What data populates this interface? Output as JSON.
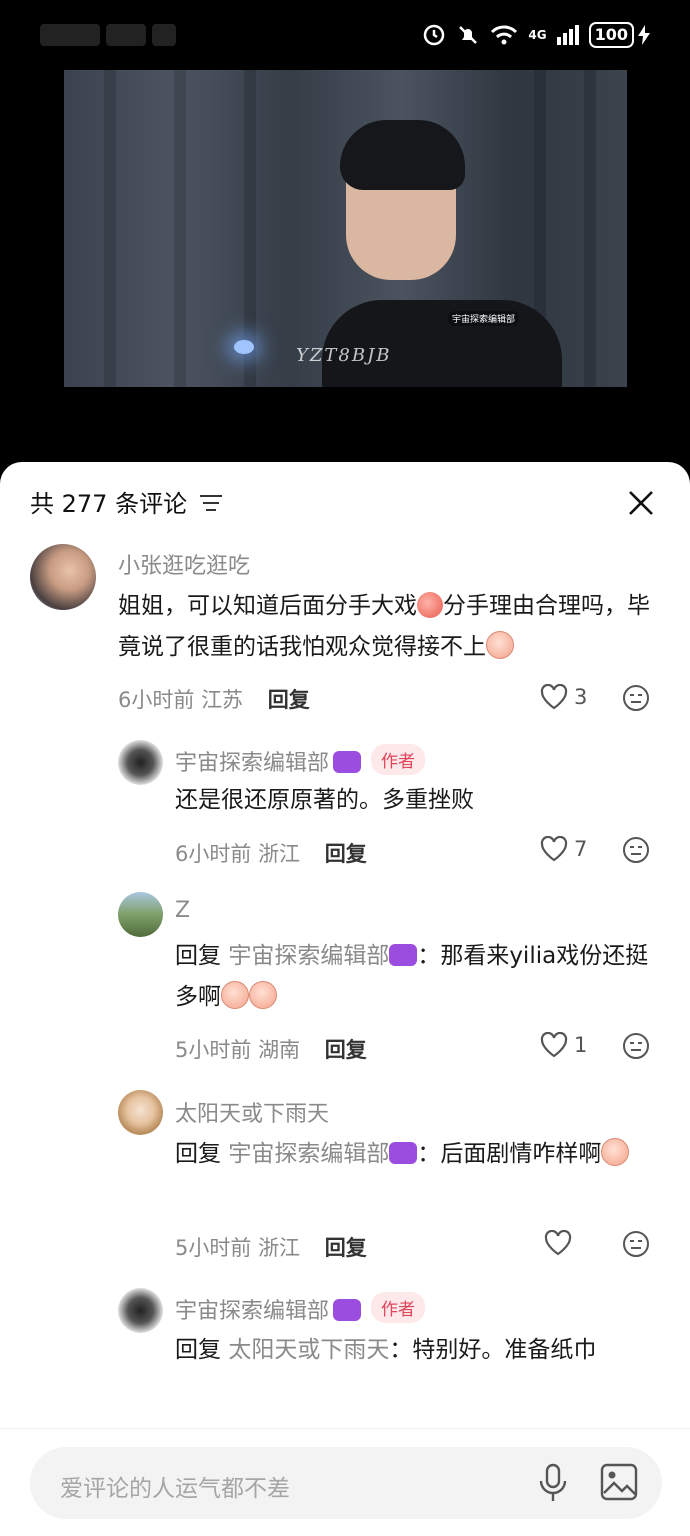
{
  "status_bar": {
    "battery": "100",
    "network": "4G"
  },
  "video": {
    "watermark_handwritten": "YZT8BJB",
    "watermark_channel": "宇宙探索编辑部"
  },
  "panel": {
    "title": "共 277 条评论",
    "input_placeholder": "爱评论的人运气都不差"
  },
  "comments": [
    {
      "username": "小张逛吃逛吃",
      "text": "姐姐，可以知道后面分手大戏",
      "text2": "分手理由合理吗，毕竟说了很重的话我怕观众觉得接不上",
      "time": "6小时前",
      "location": "江苏",
      "reply_label": "回复",
      "likes": "3"
    },
    {
      "username": "宇宙探索编辑部",
      "badge": "作者",
      "text": "还是很还原原著的。多重挫败",
      "time": "6小时前",
      "location": "浙江",
      "reply_label": "回复",
      "likes": "7"
    },
    {
      "username": "Z",
      "reply_prefix": "回复",
      "reply_to": "宇宙探索编辑部",
      "text": "：那看来yilia戏份还挺多啊",
      "time": "5小时前",
      "location": "湖南",
      "reply_label": "回复",
      "likes": "1"
    },
    {
      "username": "太阳天或下雨天",
      "reply_prefix": "回复",
      "reply_to": "宇宙探索编辑部",
      "text": "：后面剧情咋样啊",
      "time": "5小时前",
      "location": "浙江",
      "reply_label": "回复",
      "likes": ""
    },
    {
      "username": "宇宙探索编辑部",
      "badge": "作者",
      "reply_prefix": "回复",
      "reply_to": "太阳天或下雨天",
      "text": "：特别好。准备纸巾"
    }
  ]
}
